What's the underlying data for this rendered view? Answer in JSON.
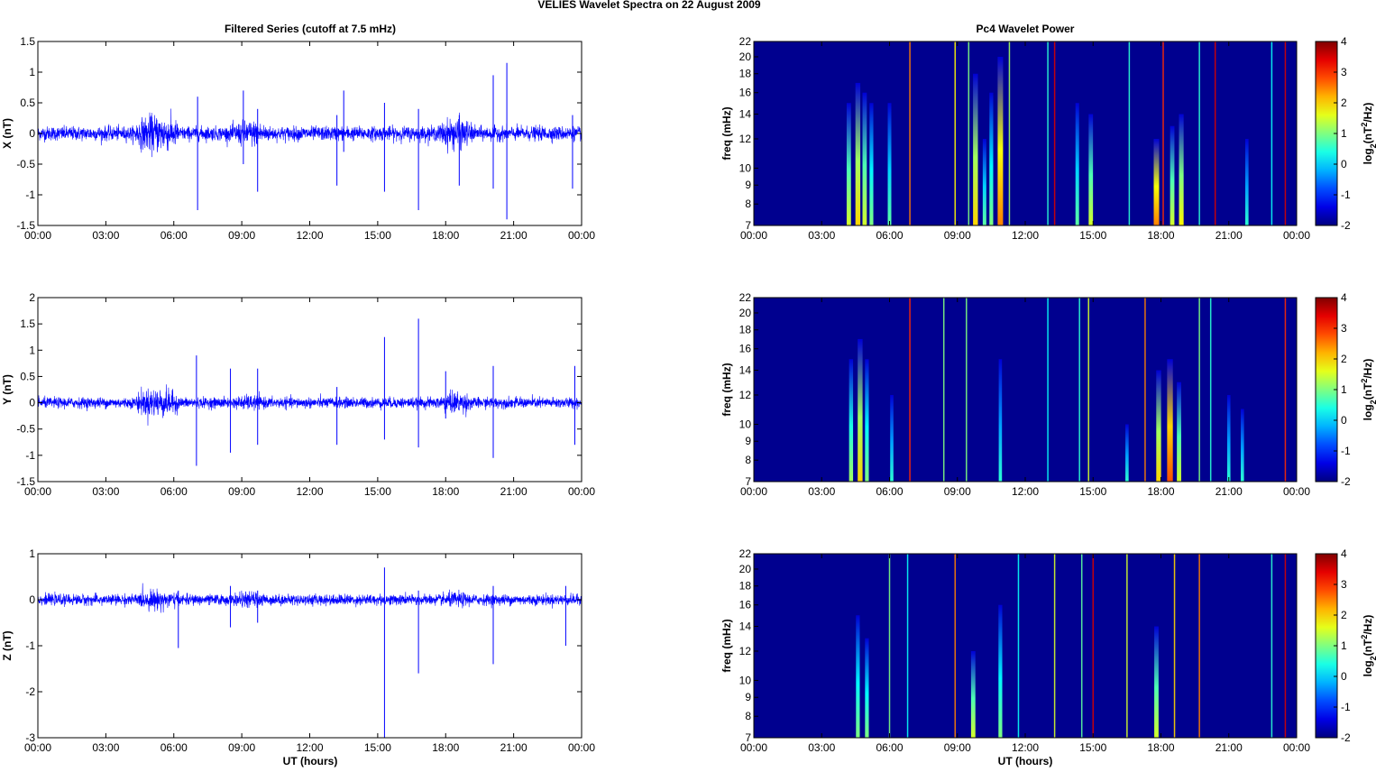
{
  "title": "VELIES Wavelet Spectra on 22 August    2009",
  "left_title": "Filtered Series (cutoff at 7.5 mHz)",
  "right_title": "Pc4 Wavelet Power",
  "xlabel": "UT (hours)",
  "time_ticks": [
    "00:00",
    "03:00",
    "06:00",
    "09:00",
    "12:00",
    "15:00",
    "18:00",
    "21:00",
    "00:00"
  ],
  "colors": {
    "trace": "#0000ff"
  },
  "chart_data": [
    {
      "type": "line",
      "panel": "X",
      "ylabel": "X (nT)",
      "ylim": [
        -1.5,
        1.5
      ],
      "yticks": [
        "-1.5",
        "-1",
        "-0.5",
        "0",
        "0.5",
        "1",
        "1.5"
      ],
      "xlim_hours": [
        0,
        24
      ],
      "noise": {
        "base": 0.08,
        "active": [
          [
            4.3,
            6.2,
            0.22
          ],
          [
            8.5,
            10.2,
            0.15
          ],
          [
            17.7,
            19.2,
            0.18
          ]
        ]
      },
      "spikes": [
        [
          7.05,
          0.6,
          -1.25
        ],
        [
          9.07,
          0.7,
          -0.5
        ],
        [
          9.7,
          0.4,
          -0.95
        ],
        [
          13.2,
          0.3,
          -0.85
        ],
        [
          13.5,
          0.7,
          -0.3
        ],
        [
          15.3,
          0.5,
          -0.95
        ],
        [
          16.8,
          0.4,
          -1.25
        ],
        [
          18.6,
          0.3,
          -0.85
        ],
        [
          20.1,
          0.95,
          -0.9
        ],
        [
          20.7,
          1.15,
          -1.4
        ],
        [
          23.6,
          0.3,
          -0.9
        ],
        [
          24.0,
          0.85,
          -1.0
        ]
      ]
    },
    {
      "type": "line",
      "panel": "Y",
      "ylabel": "Y (nT)",
      "ylim": [
        -1.5,
        2
      ],
      "yticks": [
        "-1.5",
        "-1",
        "-0.5",
        "0",
        "0.5",
        "1",
        "1.5",
        "2"
      ],
      "xlim_hours": [
        0,
        24
      ],
      "noise": {
        "base": 0.07,
        "active": [
          [
            4.3,
            6.2,
            0.2
          ],
          [
            8.5,
            10.2,
            0.1
          ],
          [
            17.7,
            19.2,
            0.15
          ]
        ]
      },
      "spikes": [
        [
          7.0,
          0.9,
          -1.2
        ],
        [
          8.5,
          0.65,
          -0.95
        ],
        [
          9.7,
          0.65,
          -0.8
        ],
        [
          13.2,
          0.3,
          -0.8
        ],
        [
          15.3,
          1.25,
          -0.7
        ],
        [
          16.8,
          1.6,
          -0.85
        ],
        [
          18.0,
          0.6,
          -0.3
        ],
        [
          20.1,
          0.7,
          -1.05
        ],
        [
          23.7,
          0.7,
          -0.8
        ]
      ]
    },
    {
      "type": "line",
      "panel": "Z",
      "ylabel": "Z (nT)",
      "ylim": [
        -3,
        1
      ],
      "yticks": [
        "-3",
        "-2",
        "-1",
        "0",
        "1"
      ],
      "xlim_hours": [
        0,
        24
      ],
      "noise": {
        "base": 0.08,
        "active": [
          [
            4.3,
            6.2,
            0.15
          ],
          [
            8.5,
            10.2,
            0.12
          ],
          [
            17.7,
            19.2,
            0.12
          ]
        ]
      },
      "spikes": [
        [
          6.2,
          0.2,
          -1.05
        ],
        [
          8.5,
          0.3,
          -0.6
        ],
        [
          9.7,
          0.2,
          -0.5
        ],
        [
          15.3,
          0.7,
          -3.0
        ],
        [
          16.8,
          0.2,
          -1.6
        ],
        [
          20.1,
          0.3,
          -1.4
        ],
        [
          23.3,
          0.3,
          -1.0
        ],
        [
          24.0,
          0.6,
          -0.7
        ]
      ]
    },
    {
      "type": "heatmap",
      "panel": "X",
      "ylabel": "freq (mHz)",
      "ylim": [
        7,
        22
      ],
      "yticks": [
        "7",
        "8",
        "9",
        "10",
        "12",
        "14",
        "16",
        "18",
        "20",
        "22"
      ],
      "clim": [
        -2,
        4
      ],
      "cbar_ticks": [
        "-2",
        "-1",
        "0",
        "1",
        "2",
        "3",
        "4"
      ],
      "cbar_label": "log2(nT2/Hz)",
      "streaks": [
        [
          4.2,
          15,
          1.5
        ],
        [
          4.6,
          17,
          2
        ],
        [
          4.9,
          16,
          1.5
        ],
        [
          5.2,
          15,
          1
        ],
        [
          6.0,
          15,
          0.8
        ],
        [
          6.9,
          22,
          2.5
        ],
        [
          8.9,
          22,
          1.8
        ],
        [
          9.5,
          22,
          1
        ],
        [
          9.8,
          18,
          2
        ],
        [
          10.2,
          12,
          0.8
        ],
        [
          10.5,
          16,
          1
        ],
        [
          10.9,
          20,
          2.5
        ],
        [
          11.3,
          22,
          1.2
        ],
        [
          13.0,
          22,
          0.5
        ],
        [
          13.3,
          22,
          3.5
        ],
        [
          14.3,
          15,
          0.8
        ],
        [
          14.9,
          14,
          1.5
        ],
        [
          16.6,
          22,
          0.5
        ],
        [
          17.8,
          12,
          2.5
        ],
        [
          18.1,
          22,
          3
        ],
        [
          18.5,
          13,
          1.5
        ],
        [
          18.9,
          14,
          1.8
        ],
        [
          19.7,
          22,
          0.5
        ],
        [
          20.4,
          22,
          3.5
        ],
        [
          21.8,
          12,
          0.5
        ],
        [
          22.9,
          22,
          0.3
        ],
        [
          23.5,
          22,
          3.5
        ]
      ]
    },
    {
      "type": "heatmap",
      "panel": "Y",
      "ylabel": "freq (mHz)",
      "ylim": [
        7,
        22
      ],
      "yticks": [
        "7",
        "8",
        "9",
        "10",
        "12",
        "14",
        "16",
        "18",
        "20",
        "22"
      ],
      "clim": [
        -2,
        4
      ],
      "cbar_ticks": [
        "-2",
        "-1",
        "0",
        "1",
        "2",
        "3",
        "4"
      ],
      "cbar_label": "log2(nT2/Hz)",
      "streaks": [
        [
          4.3,
          15,
          1.2
        ],
        [
          4.7,
          17,
          2
        ],
        [
          5.0,
          15,
          1
        ],
        [
          6.1,
          12,
          0.5
        ],
        [
          6.9,
          22,
          3
        ],
        [
          8.4,
          22,
          1
        ],
        [
          9.4,
          22,
          1
        ],
        [
          10.9,
          15,
          0.5
        ],
        [
          13.0,
          22,
          0.3
        ],
        [
          14.4,
          22,
          0.5
        ],
        [
          14.8,
          22,
          1.5
        ],
        [
          16.5,
          10,
          0.5
        ],
        [
          17.3,
          22,
          2.5
        ],
        [
          17.9,
          14,
          2
        ],
        [
          18.4,
          15,
          2.8
        ],
        [
          18.8,
          13,
          1.5
        ],
        [
          19.7,
          22,
          1
        ],
        [
          20.2,
          22,
          0.5
        ],
        [
          21.0,
          12,
          0.5
        ],
        [
          21.6,
          11,
          0.5
        ],
        [
          23.5,
          22,
          3
        ]
      ]
    },
    {
      "type": "heatmap",
      "panel": "Z",
      "ylabel": "freq (mHz)",
      "ylim": [
        7,
        22
      ],
      "yticks": [
        "7",
        "8",
        "9",
        "10",
        "12",
        "14",
        "16",
        "18",
        "20",
        "22"
      ],
      "clim": [
        -2,
        4
      ],
      "cbar_ticks": [
        "-2",
        "-1",
        "0",
        "1",
        "2",
        "3",
        "4"
      ],
      "cbar_label": "log2(nT2/Hz)",
      "streaks": [
        [
          4.6,
          15,
          1
        ],
        [
          5.0,
          13,
          1
        ],
        [
          6.0,
          22,
          1
        ],
        [
          6.8,
          22,
          0.3
        ],
        [
          8.9,
          22,
          2.5
        ],
        [
          9.7,
          12,
          1.5
        ],
        [
          10.9,
          16,
          1
        ],
        [
          11.7,
          22,
          0.3
        ],
        [
          13.3,
          22,
          1.5
        ],
        [
          14.5,
          22,
          0.8
        ],
        [
          15.0,
          22,
          3.5
        ],
        [
          16.5,
          22,
          1.5
        ],
        [
          17.8,
          14,
          1.5
        ],
        [
          18.6,
          22,
          2
        ],
        [
          19.7,
          22,
          2.5
        ],
        [
          22.9,
          22,
          0.5
        ],
        [
          23.5,
          22,
          3.5
        ]
      ]
    }
  ]
}
